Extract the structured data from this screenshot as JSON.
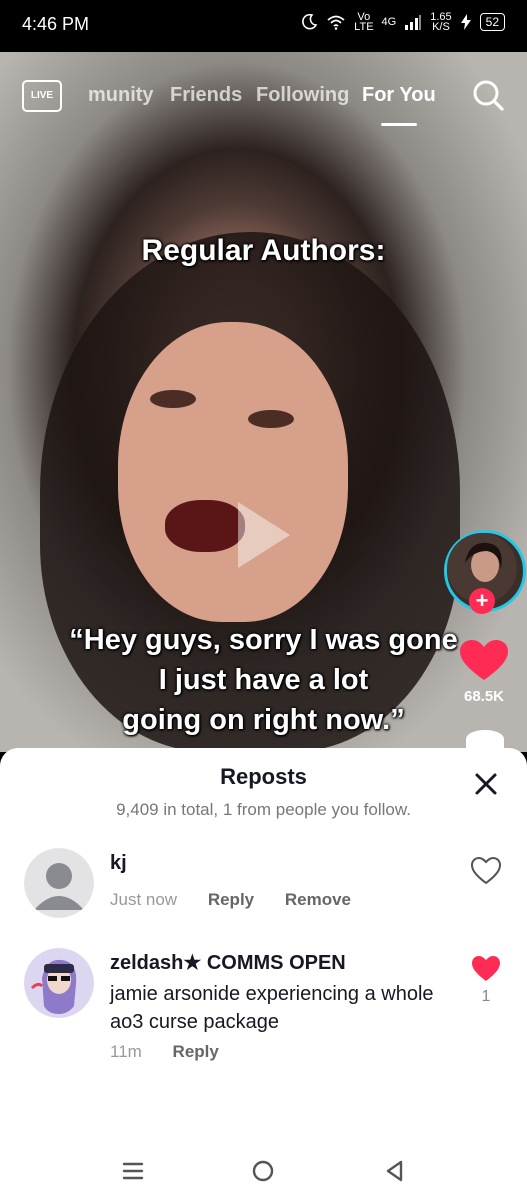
{
  "status": {
    "time": "4:46 PM",
    "net_top": "Vo",
    "net_bottom": "LTE",
    "signal": "4G",
    "speed_top": "1.65",
    "speed_bottom": "K/S",
    "battery": "52"
  },
  "top_nav": {
    "live_label": "LIVE",
    "tabs": [
      "munity",
      "Friends",
      "Following",
      "For You"
    ],
    "active_tab": "For You"
  },
  "video": {
    "caption_top": "Regular Authors:",
    "caption_lines": [
      "“Hey guys, sorry I was gone",
      "I just have a lot",
      "going on right now.”"
    ]
  },
  "side_actions": {
    "follow_symbol": "+",
    "like_count": "68.5K",
    "accent": "#fe2c55",
    "ring_color": "#20c9e5"
  },
  "sheet": {
    "title": "Reposts",
    "subtitle": "9,409 in total, 1 from people you follow.",
    "comments": [
      {
        "name": "kj",
        "text": "",
        "time": "Just now",
        "actions": [
          "Reply",
          "Remove"
        ],
        "liked": false,
        "like_count": ""
      },
      {
        "name": "zeldash★ COMMS OPEN",
        "text": "jamie arsonide experiencing a whole ao3 curse package",
        "time": "11m",
        "actions": [
          "Reply"
        ],
        "liked": true,
        "like_count": "1"
      }
    ]
  },
  "icons": {
    "menu": "menu-icon",
    "home": "home-circle-icon",
    "back": "back-triangle-icon"
  }
}
